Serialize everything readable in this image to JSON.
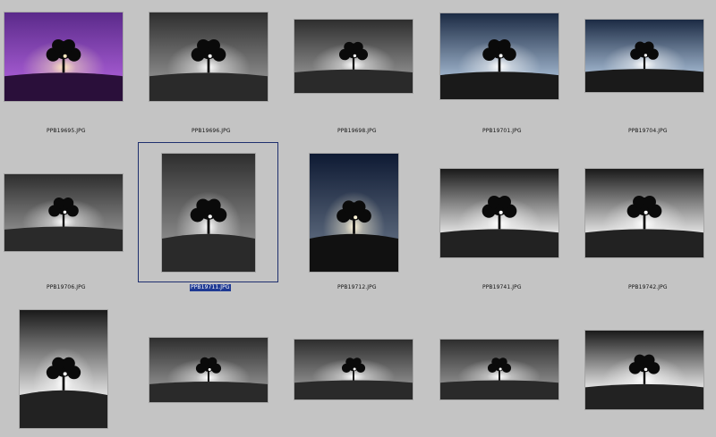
{
  "browser": {
    "selected_index": 6,
    "colors": {
      "background": "#c4c4c4",
      "selection_border": "#1f2f6e",
      "selection_label_bg": "#1f3a93"
    },
    "thumbnails": [
      {
        "filename": "PPB19695.JPG",
        "tone": "purple"
      },
      {
        "filename": "PPB19696.JPG",
        "tone": "grey"
      },
      {
        "filename": "PPB19698.JPG",
        "tone": "grey"
      },
      {
        "filename": "PPB19701.JPG",
        "tone": "blue"
      },
      {
        "filename": "PPB19704.JPG",
        "tone": "blue"
      },
      {
        "filename": "PPB19706.JPG",
        "tone": "grey"
      },
      {
        "filename": "PPB19711.JPG",
        "tone": "grey"
      },
      {
        "filename": "PPB19712.JPG",
        "tone": "navy"
      },
      {
        "filename": "PPB19741.JPG",
        "tone": "mono"
      },
      {
        "filename": "PPB19742.JPG",
        "tone": "mono"
      },
      {
        "filename": "",
        "tone": "mono"
      },
      {
        "filename": "",
        "tone": "grey"
      },
      {
        "filename": "",
        "tone": "grey"
      },
      {
        "filename": "",
        "tone": "grey"
      },
      {
        "filename": "",
        "tone": "mono"
      }
    ]
  }
}
